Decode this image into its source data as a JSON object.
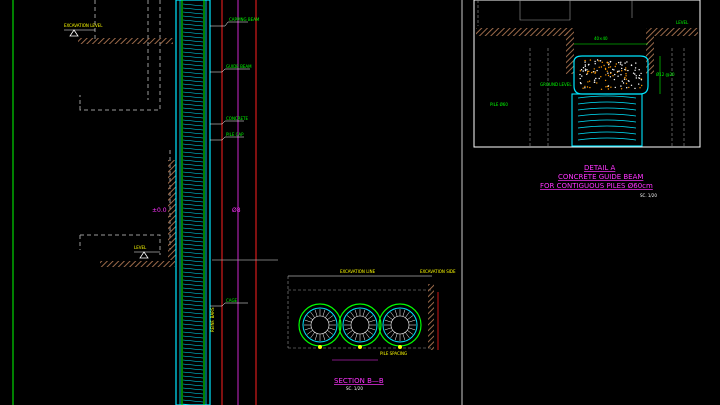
{
  "colors": {
    "background": "#000000",
    "white": "#ffffff",
    "magenta": "#ff33ff",
    "cyan": "#00e5ff",
    "green": "#00ff00",
    "red": "#ff2020",
    "yellow": "#ffff00",
    "brown": "#9c6a4a",
    "orange": "#ff9900",
    "grey": "#8a8a8a"
  },
  "left_elevation": {
    "label_excavation": "EXCAVATION LEVEL",
    "label_ground": "LEVEL",
    "callout_1": "CAPPING BEAM",
    "callout_2": "GUIDE BEAM",
    "callout_3": "CONCRETE",
    "callout_4": "PILE CAP",
    "callout_5": "CAGE",
    "dim_left": "±0.0",
    "dim_right": "Ø8",
    "bottom_callout": "REINF. BARS"
  },
  "section_bb": {
    "title": "SECTION  B—B",
    "scale": "SC. 1/20",
    "top_label": "EXCAVATION LINE",
    "right_label": "EXCAVATION SIDE",
    "bottom_label": "PILE SPACING"
  },
  "detail_a": {
    "title_line1": "DETAIL  A",
    "title_line2": "CONCRETE  GUIDE  BEAM",
    "title_line3": "FOR  CONTIGUOUS  PILES  Ø60cm",
    "scale": "SC. 1/20",
    "label_left": "GROUND LEVEL",
    "label_right": "LEVEL",
    "label_pile": "PILE Ø60",
    "label_rebar": "Ø12 @20",
    "label_side": "40×40"
  }
}
